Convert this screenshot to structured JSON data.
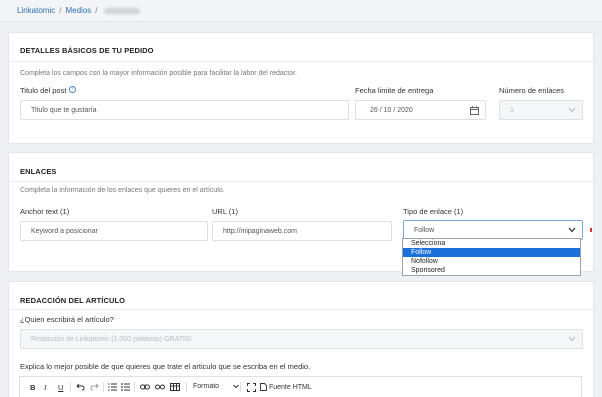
{
  "breadcrumb": {
    "root": "Linkatomic",
    "section": "Medios",
    "sep": "/"
  },
  "basic": {
    "title": "DETALLES BÁSICOS DE TU PEDIDO",
    "description": "Completa los campos con la mayor información posible para facilitar la labor del redactor.",
    "post_title_label": "Titulo del post",
    "post_title_placeholder": "Titulo que te gustaría",
    "deadline_label": "Fecha limite de entrega",
    "deadline_value": "26 / 10 / 2020",
    "links_count_label": "Número de enlaces",
    "links_count_value": "1"
  },
  "links": {
    "title": "ENLACES",
    "description": "Completa la información de los enlaces que quieres en el artículo.",
    "anchor_label": "Anchor text (1)",
    "anchor_placeholder": "Keyword a posicionar",
    "url_label": "URL (1)",
    "url_placeholder": "http://mipaginaweb.com",
    "type_label": "Tipo de enlace (1)",
    "type_value": "Follow",
    "type_options": [
      "Selecciona",
      "Follow",
      "Nofollow",
      "Sponsored"
    ],
    "type_selected_index": 1
  },
  "article": {
    "title": "REDACCIÓN DEL ARTÍCULO",
    "writer_label": "¿Quien escribirá el artículo?",
    "writer_value": "Redacción de Linkatomic (1.000 palabras) GRATIS!",
    "explain_label": "Explica lo mejor posible de que quieres que trate el articulo que se escriba en el medio.",
    "toolbar": {
      "bold": "B",
      "italic": "I",
      "underline": "U",
      "format_label": "Formato",
      "source_label": "Fuente HTML"
    }
  },
  "colors": {
    "link": "#2e6fb0",
    "selected_option": "#1a6fd8"
  }
}
